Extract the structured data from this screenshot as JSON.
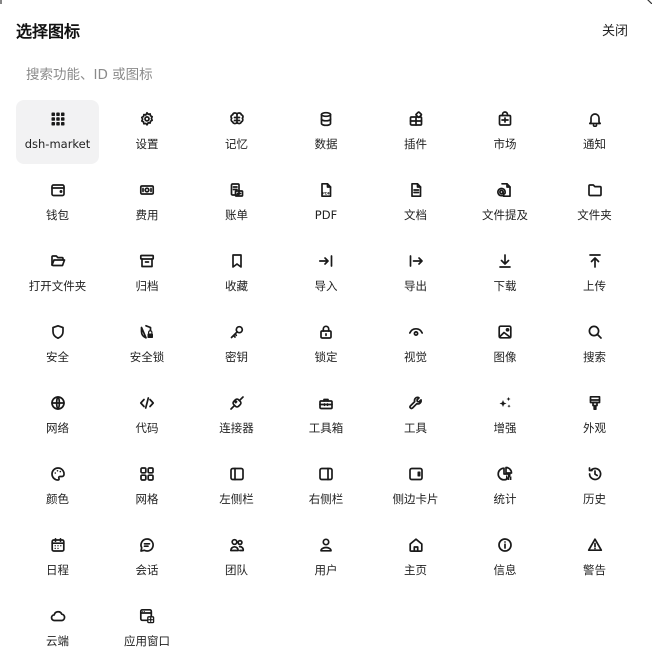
{
  "header": {
    "title": "选择图标",
    "close_label": "关闭"
  },
  "search": {
    "placeholder": "搜索功能、ID 或图标",
    "value": ""
  },
  "icons": [
    {
      "label": "dsh-market",
      "icon": "grid-dots-icon",
      "selected": true
    },
    {
      "label": "设置",
      "icon": "gear-icon"
    },
    {
      "label": "记忆",
      "icon": "brain-icon"
    },
    {
      "label": "数据",
      "icon": "database-icon"
    },
    {
      "label": "插件",
      "icon": "plugin-icon"
    },
    {
      "label": "市场",
      "icon": "store-icon"
    },
    {
      "label": "通知",
      "icon": "bell-icon"
    },
    {
      "label": "钱包",
      "icon": "wallet-icon"
    },
    {
      "label": "费用",
      "icon": "banknote-icon"
    },
    {
      "label": "账单",
      "icon": "receipt-icon"
    },
    {
      "label": "PDF",
      "icon": "pdf-file-icon"
    },
    {
      "label": "文档",
      "icon": "file-text-icon"
    },
    {
      "label": "文件提及",
      "icon": "file-mention-icon"
    },
    {
      "label": "文件夹",
      "icon": "folder-icon"
    },
    {
      "label": "打开文件夹",
      "icon": "folder-open-icon"
    },
    {
      "label": "归档",
      "icon": "archive-icon"
    },
    {
      "label": "收藏",
      "icon": "bookmark-icon"
    },
    {
      "label": "导入",
      "icon": "import-icon"
    },
    {
      "label": "导出",
      "icon": "export-icon"
    },
    {
      "label": "下载",
      "icon": "download-icon"
    },
    {
      "label": "上传",
      "icon": "upload-icon"
    },
    {
      "label": "安全",
      "icon": "shield-icon"
    },
    {
      "label": "安全锁",
      "icon": "shield-lock-icon"
    },
    {
      "label": "密钥",
      "icon": "key-icon"
    },
    {
      "label": "锁定",
      "icon": "lock-icon"
    },
    {
      "label": "视觉",
      "icon": "eye-icon"
    },
    {
      "label": "图像",
      "icon": "image-icon"
    },
    {
      "label": "搜索",
      "icon": "search-icon"
    },
    {
      "label": "网络",
      "icon": "globe-icon"
    },
    {
      "label": "代码",
      "icon": "code-icon"
    },
    {
      "label": "连接器",
      "icon": "plug-icon"
    },
    {
      "label": "工具箱",
      "icon": "toolbox-icon"
    },
    {
      "label": "工具",
      "icon": "wrench-icon"
    },
    {
      "label": "增强",
      "icon": "sparkles-icon"
    },
    {
      "label": "外观",
      "icon": "paintbrush-icon"
    },
    {
      "label": "颜色",
      "icon": "palette-icon"
    },
    {
      "label": "网格",
      "icon": "grid-icon"
    },
    {
      "label": "左侧栏",
      "icon": "panel-left-icon"
    },
    {
      "label": "右侧栏",
      "icon": "panel-right-icon"
    },
    {
      "label": "侧边卡片",
      "icon": "side-card-icon"
    },
    {
      "label": "统计",
      "icon": "chart-pie-icon"
    },
    {
      "label": "历史",
      "icon": "history-icon"
    },
    {
      "label": "日程",
      "icon": "calendar-icon"
    },
    {
      "label": "会话",
      "icon": "chat-icon"
    },
    {
      "label": "团队",
      "icon": "users-icon"
    },
    {
      "label": "用户",
      "icon": "user-icon"
    },
    {
      "label": "主页",
      "icon": "home-icon"
    },
    {
      "label": "信息",
      "icon": "info-icon"
    },
    {
      "label": "警告",
      "icon": "warning-icon"
    },
    {
      "label": "云端",
      "icon": "cloud-icon"
    },
    {
      "label": "应用窗口",
      "icon": "app-window-icon"
    }
  ]
}
